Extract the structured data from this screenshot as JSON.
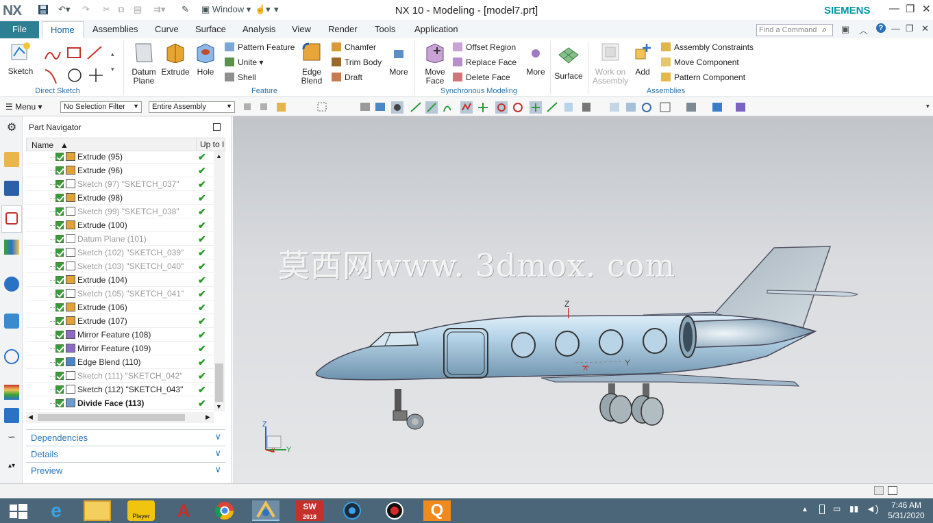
{
  "app": {
    "logo": "NX",
    "title": "NX 10 - Modeling - [model7.prt]",
    "brand": "SIEMENS",
    "accent": "#2d8094"
  },
  "quick_access": {
    "window_label": "Window"
  },
  "ribbon_tabs": [
    "File",
    "Home",
    "Assemblies",
    "Curve",
    "Surface",
    "Analysis",
    "View",
    "Render",
    "Tools",
    "Application"
  ],
  "find_command": {
    "placeholder": "Find a Command"
  },
  "ribbon": {
    "direct_sketch": {
      "sketch": "Sketch",
      "group": "Direct Sketch"
    },
    "feature": {
      "datum_plane": "Datum Plane",
      "extrude": "Extrude",
      "hole": "Hole",
      "pattern_feature": "Pattern Feature",
      "unite": "Unite",
      "shell": "Shell",
      "edge_blend": "Edge Blend",
      "chamfer": "Chamfer",
      "trim_body": "Trim Body",
      "draft": "Draft",
      "more": "More",
      "group": "Feature"
    },
    "synchronous": {
      "move_face": "Move Face",
      "offset_region": "Offset Region",
      "replace_face": "Replace Face",
      "delete_face": "Delete Face",
      "more": "More",
      "group": "Synchronous Modeling"
    },
    "surface": {
      "label": "Surface"
    },
    "assemblies": {
      "work_on_assembly": "Work on Assembly",
      "add": "Add",
      "assembly_constraints": "Assembly Constraints",
      "move_component": "Move Component",
      "pattern_component": "Pattern Component",
      "group": "Assemblies"
    }
  },
  "toolbar2": {
    "menu": "Menu",
    "selection_filter": "No Selection Filter",
    "scope": "Entire Assembly"
  },
  "navigator": {
    "title": "Part Navigator",
    "col_name": "Name",
    "col_uptodate": "Up to I",
    "rows": [
      {
        "label": "Extrude (95)",
        "type": "extrude",
        "dim": false,
        "bold": false
      },
      {
        "label": "Extrude (96)",
        "type": "extrude",
        "dim": false,
        "bold": false
      },
      {
        "label": "Sketch (97) \"SKETCH_037\"",
        "type": "sketch",
        "dim": true,
        "bold": false
      },
      {
        "label": "Extrude (98)",
        "type": "extrude",
        "dim": false,
        "bold": false
      },
      {
        "label": "Sketch (99) \"SKETCH_038\"",
        "type": "sketch",
        "dim": true,
        "bold": false
      },
      {
        "label": "Extrude (100)",
        "type": "extrude",
        "dim": false,
        "bold": false
      },
      {
        "label": "Datum Plane (101)",
        "type": "datum",
        "dim": true,
        "bold": false
      },
      {
        "label": "Sketch (102) \"SKETCH_039\"",
        "type": "sketch",
        "dim": true,
        "bold": false
      },
      {
        "label": "Sketch (103) \"SKETCH_040\"",
        "type": "sketch",
        "dim": true,
        "bold": false
      },
      {
        "label": "Extrude (104)",
        "type": "extrude",
        "dim": false,
        "bold": false
      },
      {
        "label": "Sketch (105) \"SKETCH_041\"",
        "type": "sketch",
        "dim": true,
        "bold": false
      },
      {
        "label": "Extrude (106)",
        "type": "extrude",
        "dim": false,
        "bold": false
      },
      {
        "label": "Extrude (107)",
        "type": "extrude",
        "dim": false,
        "bold": false
      },
      {
        "label": "Mirror Feature (108)",
        "type": "mirror",
        "dim": false,
        "bold": false
      },
      {
        "label": "Mirror Feature (109)",
        "type": "mirror",
        "dim": false,
        "bold": false
      },
      {
        "label": "Edge Blend (110)",
        "type": "blend",
        "dim": false,
        "bold": false
      },
      {
        "label": "Sketch (111) \"SKETCH_042\"",
        "type": "sketch",
        "dim": true,
        "bold": false
      },
      {
        "label": "Sketch (112) \"SKETCH_043\"",
        "type": "sketch",
        "dim": false,
        "bold": false
      },
      {
        "label": "Divide Face (113)",
        "type": "divide",
        "dim": false,
        "bold": true
      }
    ],
    "panels": [
      "Dependencies",
      "Details",
      "Preview"
    ]
  },
  "viewport": {
    "watermark": "莫西网www. 3dmox. com",
    "axis_z": "Z",
    "axis_y": "Y",
    "axis_x": "X",
    "model_axis_z": "Z",
    "model_axis_y": "Y",
    "model_axis_x": "X"
  },
  "taskbar": {
    "time": "7:46 AM",
    "date": "5/31/2020",
    "sw_label": "2018",
    "player_label": "Player"
  }
}
